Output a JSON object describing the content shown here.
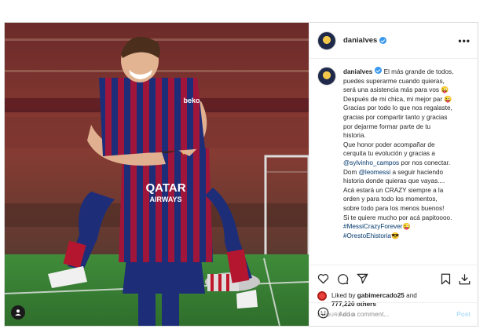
{
  "post": {
    "author": "danialves",
    "more_icon": "more-horizontal-icon",
    "caption_lines": [
      {
        "parts": [
          {
            "t": "El más grande de todos,",
            "k": "text"
          }
        ]
      },
      {
        "parts": [
          {
            "t": "puedes superarme cuando quieras,",
            "k": "text"
          }
        ]
      },
      {
        "parts": [
          {
            "t": "será una asistencia más para vos 😜",
            "k": "text"
          }
        ]
      },
      {
        "parts": [
          {
            "t": "Después de mi chica, mi mejor par 😜",
            "k": "text"
          }
        ]
      },
      {
        "parts": [
          {
            "t": "Gracias por todo lo que nos regalaste,",
            "k": "text"
          }
        ]
      },
      {
        "parts": [
          {
            "t": "gracias por compartir tanto y gracias",
            "k": "text"
          }
        ]
      },
      {
        "parts": [
          {
            "t": "por dejarme formar parte de tu",
            "k": "text"
          }
        ]
      },
      {
        "parts": [
          {
            "t": "historia.",
            "k": "text"
          }
        ]
      },
      {
        "parts": [
          {
            "t": "Que honor poder acompañar de",
            "k": "text"
          }
        ]
      },
      {
        "parts": [
          {
            "t": "cerquita tu evolución y gracias a",
            "k": "text"
          }
        ]
      },
      {
        "parts": [
          {
            "t": "@sylvinho_campos",
            "k": "mention"
          },
          {
            "t": " por nos conectar.",
            "k": "text"
          }
        ]
      },
      {
        "parts": [
          {
            "t": "Dom ",
            "k": "text"
          },
          {
            "t": "@leomessi",
            "k": "mention"
          },
          {
            "t": " a seguir haciendo",
            "k": "text"
          }
        ]
      },
      {
        "parts": [
          {
            "t": "historia donde quieras que vayas....",
            "k": "text"
          }
        ]
      },
      {
        "parts": [
          {
            "t": "Acá estará un CRAZY siempre a la",
            "k": "text"
          }
        ]
      },
      {
        "parts": [
          {
            "t": "orden y para todo los momentos,",
            "k": "text"
          }
        ]
      },
      {
        "parts": [
          {
            "t": "sobre todo para los menos buenos!",
            "k": "text"
          }
        ]
      },
      {
        "parts": [
          {
            "t": "Si te quiere mucho por acá papitoooo.",
            "k": "text"
          }
        ]
      },
      {
        "parts": [
          {
            "t": "#MessiCrazyForever",
            "k": "hashtag"
          },
          {
            "t": "😜",
            "k": "text"
          }
        ]
      },
      {
        "parts": [
          {
            "t": "#OrestoEhistoria",
            "k": "hashtag"
          },
          {
            "t": "😎",
            "k": "text"
          }
        ]
      }
    ],
    "liked_by_prefix": "Liked by ",
    "liked_by_user": "gabimercado25",
    "liked_by_joiner": " and",
    "others_count": "777,220 others",
    "timestamp": "2 HOURS AGO",
    "comment_placeholder": "Add a comment...",
    "post_button": "Post",
    "icons": [
      "heart-icon",
      "comment-icon",
      "share-icon",
      "bookmark-icon",
      "download-icon",
      "emoji-icon",
      "user-tag-icon"
    ]
  },
  "photo": {
    "jersey_text_1": "QATAR",
    "jersey_text_2": "AIRWAYS",
    "sleeve_text": "beko"
  }
}
